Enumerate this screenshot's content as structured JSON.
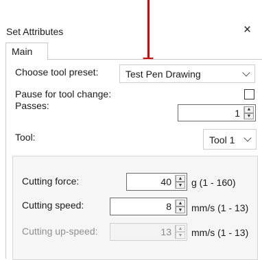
{
  "dialog": {
    "title": "Set Attributes",
    "close_glyph": "×"
  },
  "tabs": [
    {
      "label": "Main"
    }
  ],
  "fields": {
    "tool_preset": {
      "label": "Choose tool preset:",
      "value": "Test Pen Drawing"
    },
    "pause_tool_change": {
      "label": "Pause for tool change:",
      "checked": false
    },
    "passes": {
      "label": "Passes:",
      "value": "1"
    },
    "tool": {
      "label": "Tool:",
      "value": "Tool 1"
    }
  },
  "cutting": {
    "force": {
      "label": "Cutting force:",
      "value": "40",
      "unit": "g (1 - 160)"
    },
    "speed": {
      "label": "Cutting speed:",
      "value": "8",
      "unit": "mm/s (1 - 13)"
    },
    "up_speed": {
      "label": "Cutting up-speed:",
      "value": "13",
      "unit": "mm/s (1 - 13)",
      "disabled": true
    }
  },
  "icons": {
    "spin_up": "▲",
    "spin_down": "▼"
  },
  "colors": {
    "arrow": "#e00000"
  }
}
